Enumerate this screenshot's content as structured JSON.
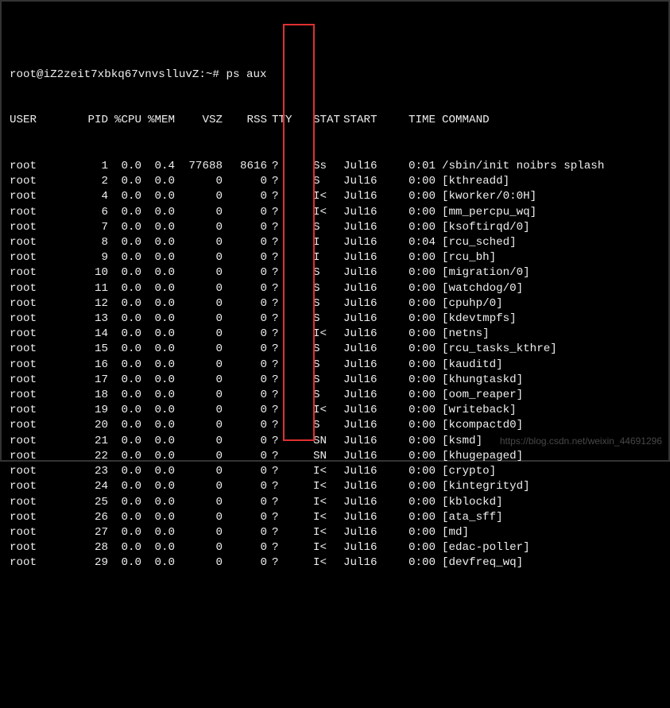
{
  "prompt": {
    "text": "root@iZ2zeit7xbkq67vnvslluvZ:~#",
    "command": "ps aux"
  },
  "headers": {
    "user": "USER",
    "pid": "PID",
    "cpu": "%CPU",
    "mem": "%MEM",
    "vsz": "VSZ",
    "rss": "RSS",
    "tty": "TTY",
    "stat": "STAT",
    "start": "START",
    "time": "TIME",
    "command": "COMMAND"
  },
  "rows": [
    {
      "user": "root",
      "pid": "1",
      "cpu": "0.0",
      "mem": "0.4",
      "vsz": "77688",
      "rss": "8616",
      "tty": "?",
      "stat": "Ss",
      "start": "Jul16",
      "time": "0:01",
      "cmd": "/sbin/init noibrs splash"
    },
    {
      "user": "root",
      "pid": "2",
      "cpu": "0.0",
      "mem": "0.0",
      "vsz": "0",
      "rss": "0",
      "tty": "?",
      "stat": "S",
      "start": "Jul16",
      "time": "0:00",
      "cmd": "[kthreadd]"
    },
    {
      "user": "root",
      "pid": "4",
      "cpu": "0.0",
      "mem": "0.0",
      "vsz": "0",
      "rss": "0",
      "tty": "?",
      "stat": "I<",
      "start": "Jul16",
      "time": "0:00",
      "cmd": "[kworker/0:0H]"
    },
    {
      "user": "root",
      "pid": "6",
      "cpu": "0.0",
      "mem": "0.0",
      "vsz": "0",
      "rss": "0",
      "tty": "?",
      "stat": "I<",
      "start": "Jul16",
      "time": "0:00",
      "cmd": "[mm_percpu_wq]"
    },
    {
      "user": "root",
      "pid": "7",
      "cpu": "0.0",
      "mem": "0.0",
      "vsz": "0",
      "rss": "0",
      "tty": "?",
      "stat": "S",
      "start": "Jul16",
      "time": "0:00",
      "cmd": "[ksoftirqd/0]"
    },
    {
      "user": "root",
      "pid": "8",
      "cpu": "0.0",
      "mem": "0.0",
      "vsz": "0",
      "rss": "0",
      "tty": "?",
      "stat": "I",
      "start": "Jul16",
      "time": "0:04",
      "cmd": "[rcu_sched]"
    },
    {
      "user": "root",
      "pid": "9",
      "cpu": "0.0",
      "mem": "0.0",
      "vsz": "0",
      "rss": "0",
      "tty": "?",
      "stat": "I",
      "start": "Jul16",
      "time": "0:00",
      "cmd": "[rcu_bh]"
    },
    {
      "user": "root",
      "pid": "10",
      "cpu": "0.0",
      "mem": "0.0",
      "vsz": "0",
      "rss": "0",
      "tty": "?",
      "stat": "S",
      "start": "Jul16",
      "time": "0:00",
      "cmd": "[migration/0]"
    },
    {
      "user": "root",
      "pid": "11",
      "cpu": "0.0",
      "mem": "0.0",
      "vsz": "0",
      "rss": "0",
      "tty": "?",
      "stat": "S",
      "start": "Jul16",
      "time": "0:00",
      "cmd": "[watchdog/0]"
    },
    {
      "user": "root",
      "pid": "12",
      "cpu": "0.0",
      "mem": "0.0",
      "vsz": "0",
      "rss": "0",
      "tty": "?",
      "stat": "S",
      "start": "Jul16",
      "time": "0:00",
      "cmd": "[cpuhp/0]"
    },
    {
      "user": "root",
      "pid": "13",
      "cpu": "0.0",
      "mem": "0.0",
      "vsz": "0",
      "rss": "0",
      "tty": "?",
      "stat": "S",
      "start": "Jul16",
      "time": "0:00",
      "cmd": "[kdevtmpfs]"
    },
    {
      "user": "root",
      "pid": "14",
      "cpu": "0.0",
      "mem": "0.0",
      "vsz": "0",
      "rss": "0",
      "tty": "?",
      "stat": "I<",
      "start": "Jul16",
      "time": "0:00",
      "cmd": "[netns]"
    },
    {
      "user": "root",
      "pid": "15",
      "cpu": "0.0",
      "mem": "0.0",
      "vsz": "0",
      "rss": "0",
      "tty": "?",
      "stat": "S",
      "start": "Jul16",
      "time": "0:00",
      "cmd": "[rcu_tasks_kthre]"
    },
    {
      "user": "root",
      "pid": "16",
      "cpu": "0.0",
      "mem": "0.0",
      "vsz": "0",
      "rss": "0",
      "tty": "?",
      "stat": "S",
      "start": "Jul16",
      "time": "0:00",
      "cmd": "[kauditd]"
    },
    {
      "user": "root",
      "pid": "17",
      "cpu": "0.0",
      "mem": "0.0",
      "vsz": "0",
      "rss": "0",
      "tty": "?",
      "stat": "S",
      "start": "Jul16",
      "time": "0:00",
      "cmd": "[khungtaskd]"
    },
    {
      "user": "root",
      "pid": "18",
      "cpu": "0.0",
      "mem": "0.0",
      "vsz": "0",
      "rss": "0",
      "tty": "?",
      "stat": "S",
      "start": "Jul16",
      "time": "0:00",
      "cmd": "[oom_reaper]"
    },
    {
      "user": "root",
      "pid": "19",
      "cpu": "0.0",
      "mem": "0.0",
      "vsz": "0",
      "rss": "0",
      "tty": "?",
      "stat": "I<",
      "start": "Jul16",
      "time": "0:00",
      "cmd": "[writeback]"
    },
    {
      "user": "root",
      "pid": "20",
      "cpu": "0.0",
      "mem": "0.0",
      "vsz": "0",
      "rss": "0",
      "tty": "?",
      "stat": "S",
      "start": "Jul16",
      "time": "0:00",
      "cmd": "[kcompactd0]"
    },
    {
      "user": "root",
      "pid": "21",
      "cpu": "0.0",
      "mem": "0.0",
      "vsz": "0",
      "rss": "0",
      "tty": "?",
      "stat": "SN",
      "start": "Jul16",
      "time": "0:00",
      "cmd": "[ksmd]"
    },
    {
      "user": "root",
      "pid": "22",
      "cpu": "0.0",
      "mem": "0.0",
      "vsz": "0",
      "rss": "0",
      "tty": "?",
      "stat": "SN",
      "start": "Jul16",
      "time": "0:00",
      "cmd": "[khugepaged]"
    },
    {
      "user": "root",
      "pid": "23",
      "cpu": "0.0",
      "mem": "0.0",
      "vsz": "0",
      "rss": "0",
      "tty": "?",
      "stat": "I<",
      "start": "Jul16",
      "time": "0:00",
      "cmd": "[crypto]"
    },
    {
      "user": "root",
      "pid": "24",
      "cpu": "0.0",
      "mem": "0.0",
      "vsz": "0",
      "rss": "0",
      "tty": "?",
      "stat": "I<",
      "start": "Jul16",
      "time": "0:00",
      "cmd": "[kintegrityd]"
    },
    {
      "user": "root",
      "pid": "25",
      "cpu": "0.0",
      "mem": "0.0",
      "vsz": "0",
      "rss": "0",
      "tty": "?",
      "stat": "I<",
      "start": "Jul16",
      "time": "0:00",
      "cmd": "[kblockd]"
    },
    {
      "user": "root",
      "pid": "26",
      "cpu": "0.0",
      "mem": "0.0",
      "vsz": "0",
      "rss": "0",
      "tty": "?",
      "stat": "I<",
      "start": "Jul16",
      "time": "0:00",
      "cmd": "[ata_sff]"
    },
    {
      "user": "root",
      "pid": "27",
      "cpu": "0.0",
      "mem": "0.0",
      "vsz": "0",
      "rss": "0",
      "tty": "?",
      "stat": "I<",
      "start": "Jul16",
      "time": "0:00",
      "cmd": "[md]"
    },
    {
      "user": "root",
      "pid": "28",
      "cpu": "0.0",
      "mem": "0.0",
      "vsz": "0",
      "rss": "0",
      "tty": "?",
      "stat": "I<",
      "start": "Jul16",
      "time": "0:00",
      "cmd": "[edac-poller]"
    },
    {
      "user": "root",
      "pid": "29",
      "cpu": "0.0",
      "mem": "0.0",
      "vsz": "0",
      "rss": "0",
      "tty": "?",
      "stat": "I<",
      "start": "Jul16",
      "time": "0:00",
      "cmd": "[devfreq_wq]"
    }
  ],
  "watermark": "https://blog.csdn.net/weixin_44691296"
}
